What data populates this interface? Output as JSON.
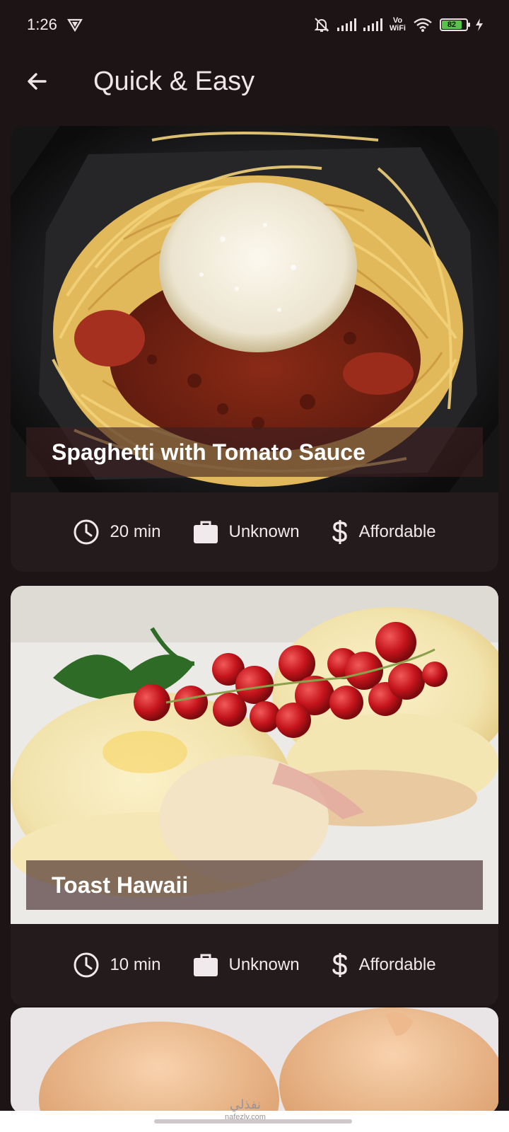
{
  "status": {
    "time": "1:26",
    "vo_wifi_top": "Vo",
    "vo_wifi_bottom": "WiFi",
    "battery": "82"
  },
  "app_bar": {
    "title": "Quick & Easy"
  },
  "recipes": [
    {
      "title": "Spaghetti with Tomato Sauce",
      "duration": "20 min",
      "complexity": "Unknown",
      "affordability": "Affordable"
    },
    {
      "title": "Toast Hawaii",
      "duration": "10 min",
      "complexity": "Unknown",
      "affordability": "Affordable"
    }
  ],
  "watermark": {
    "arabic": "نفذلي",
    "latin": "nafezly.com"
  },
  "icons": {
    "back": "arrow-left-icon",
    "clock": "clock-icon",
    "briefcase": "briefcase-icon",
    "dollar": "dollar-icon"
  },
  "colors": {
    "background": "#1c1415",
    "card": "#241b1c",
    "battery": "#57c34a"
  }
}
